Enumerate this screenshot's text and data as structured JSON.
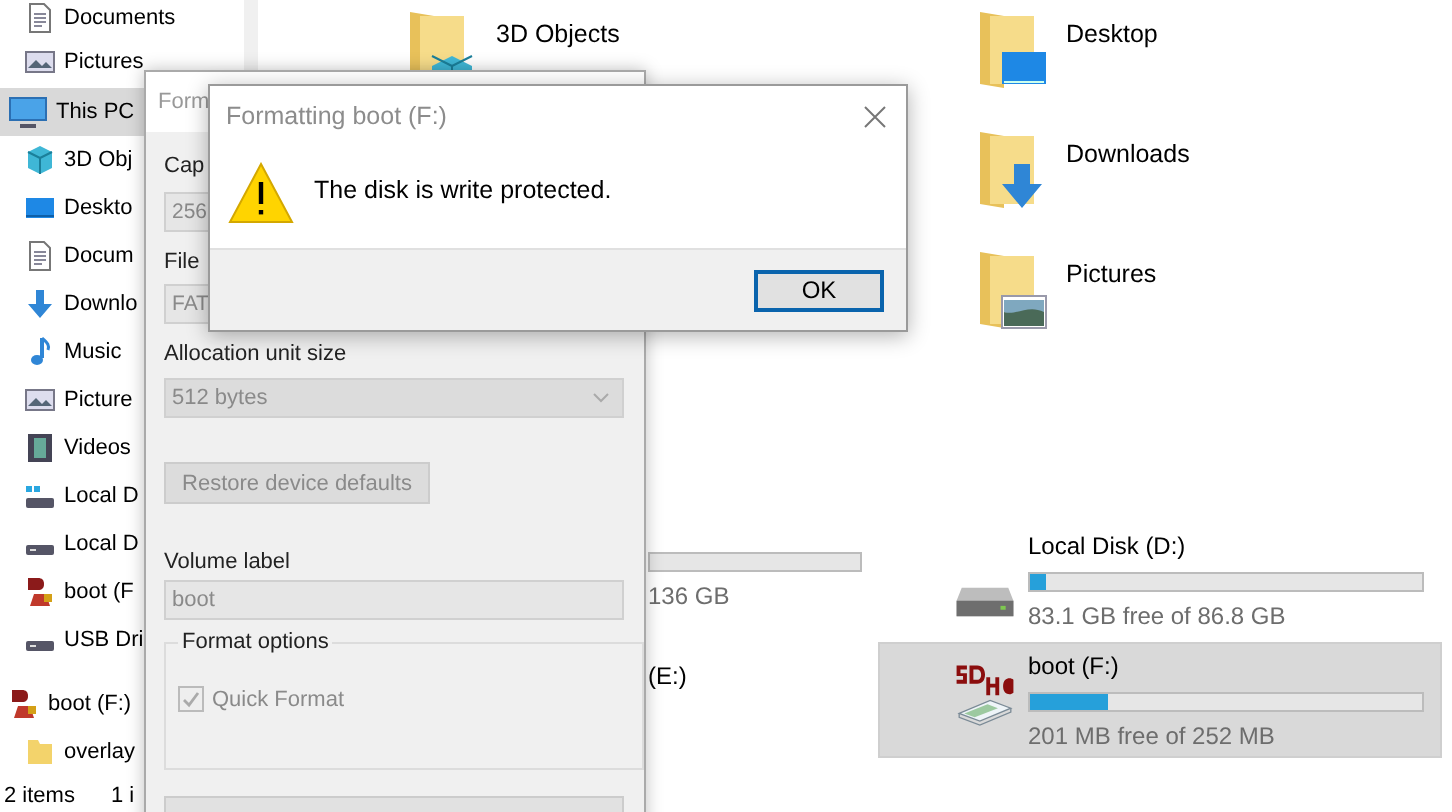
{
  "sidebar": {
    "groups": [
      {
        "children": [
          {
            "label": "Documents",
            "kind": "doc"
          },
          {
            "label": "Pictures",
            "kind": "picture"
          }
        ]
      },
      {
        "label": "This PC",
        "kind": "pc",
        "selected": true,
        "children": [
          {
            "label": "3D Obj",
            "kind": "cube"
          },
          {
            "label": "Deskto",
            "kind": "desktop"
          },
          {
            "label": "Docum",
            "kind": "doc"
          },
          {
            "label": "Downlo",
            "kind": "download"
          },
          {
            "label": "Music",
            "kind": "music"
          },
          {
            "label": "Picture",
            "kind": "picture"
          },
          {
            "label": "Videos",
            "kind": "video"
          },
          {
            "label": "Local D",
            "kind": "drive-win"
          },
          {
            "label": "Local D",
            "kind": "drive"
          },
          {
            "label": "boot (F",
            "kind": "sd"
          },
          {
            "label": "USB Dri",
            "kind": "drive"
          }
        ]
      },
      {
        "label": "boot (F:)",
        "kind": "sd",
        "selected": false,
        "children": [
          {
            "label": "overlay",
            "kind": "folder"
          }
        ]
      }
    ]
  },
  "folder_columns": [
    {
      "items": [
        {
          "label": "3D Objects",
          "kind": "cube"
        }
      ]
    },
    {
      "items": [
        {
          "label": "Desktop",
          "kind": "desktop"
        },
        {
          "label": "Downloads",
          "kind": "download"
        },
        {
          "label": "Pictures",
          "kind": "picture"
        }
      ]
    }
  ],
  "drive_columns": [
    {
      "items": [
        {
          "usage": "136 GB"
        },
        {
          "name": "(E:)"
        }
      ]
    },
    {
      "items": [
        {
          "name": "Local Disk (D:)",
          "kind": "hdd",
          "level": 0.04,
          "usage": "83.1 GB free of 86.8 GB",
          "selected": false
        },
        {
          "name": "boot (F:)",
          "kind": "sd",
          "level": 0.2,
          "usage": "201 MB free of 252 MB",
          "selected": true
        }
      ]
    }
  ],
  "status_bar": {
    "items_count": "2 items",
    "selection": "1 i"
  },
  "format_dialog": {
    "title": "Form",
    "capacity_label": "Cap",
    "capacity": "256",
    "filesystem_label": "File",
    "filesystem": "FAT",
    "allocation_label": "Allocation unit size",
    "allocation": "512 bytes",
    "restore_button": "Restore device defaults",
    "volume_label": "Volume label",
    "volume": "boot",
    "options_title": "Format options",
    "quick_format": {
      "label": "Quick Format",
      "checked": true,
      "disabled": true
    }
  },
  "message_box": {
    "title": "Formatting boot (F:)",
    "message": "The disk is write protected.",
    "button": "OK"
  }
}
